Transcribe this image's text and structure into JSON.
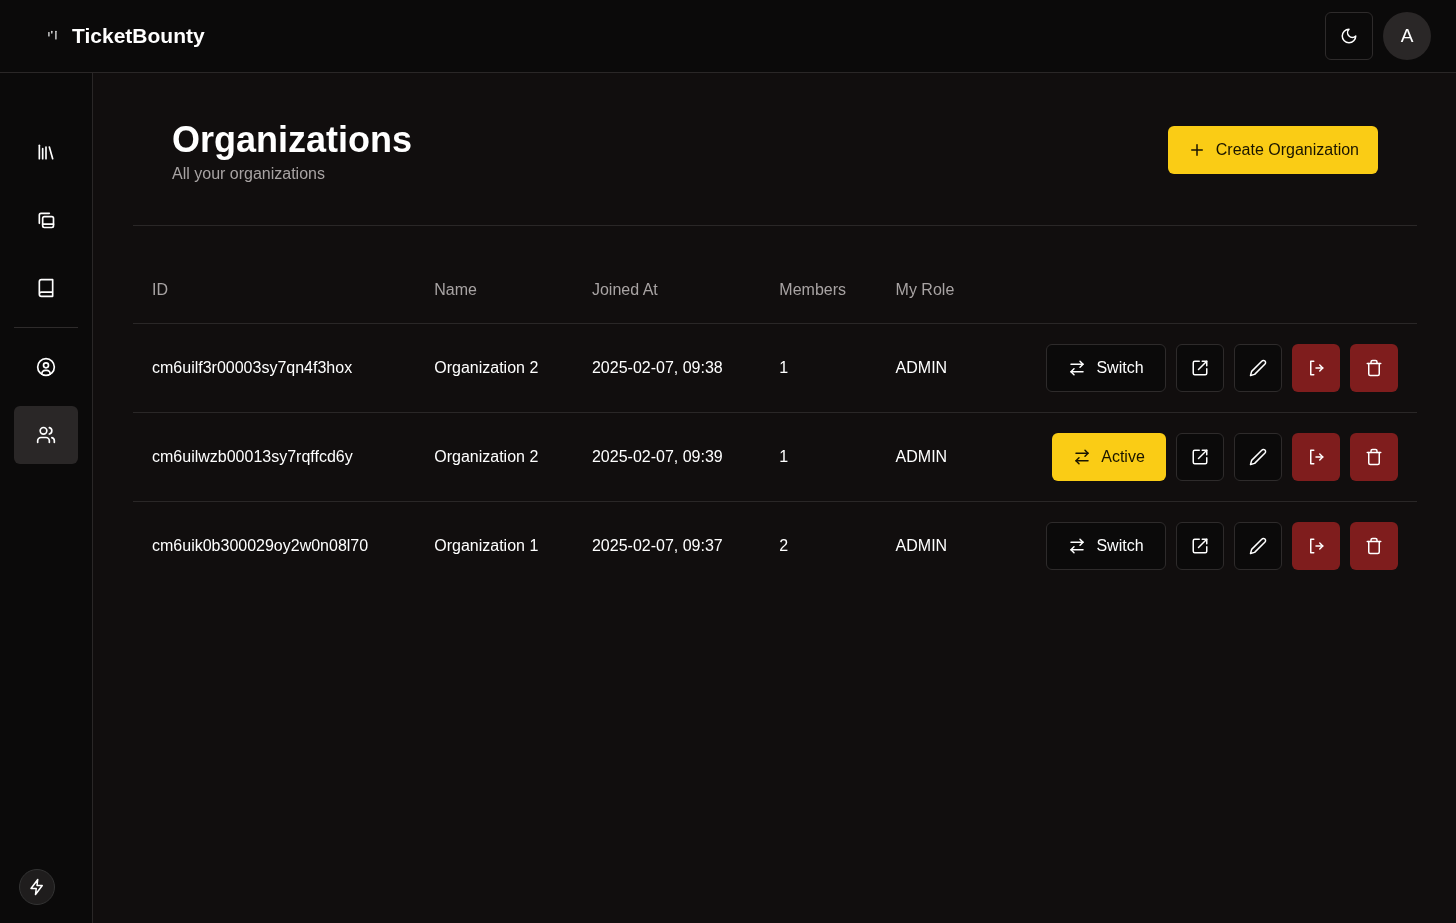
{
  "app": {
    "name": "TicketBounty"
  },
  "header": {
    "avatar": "A"
  },
  "sidebar": {
    "items": [
      {
        "kind": "library",
        "selected": false
      },
      {
        "kind": "copies",
        "selected": false
      },
      {
        "kind": "book",
        "selected": false
      },
      {
        "kind": "account",
        "selected": false
      },
      {
        "kind": "users",
        "selected": true
      }
    ]
  },
  "page": {
    "title": "Organizations",
    "subtitle": "All your organizations",
    "create_button": "Create Organization"
  },
  "table": {
    "columns": [
      "ID",
      "Name",
      "Joined At",
      "Members",
      "My Role"
    ],
    "rows": [
      {
        "id": "cm6uilf3r00003sy7qn4f3hox",
        "name": "Organization 2",
        "joined_at": "2025-02-07, 09:38",
        "members": "1",
        "role": "ADMIN",
        "selected": false,
        "switch_label": "Switch"
      },
      {
        "id": "cm6uilwzb00013sy7rqffcd6y",
        "name": "Organization 2",
        "joined_at": "2025-02-07, 09:39",
        "members": "1",
        "role": "ADMIN",
        "selected": true,
        "switch_label": "Active"
      },
      {
        "id": "cm6uik0b300029oy2w0n08l70",
        "name": "Organization 1",
        "joined_at": "2025-02-07, 09:37",
        "members": "2",
        "role": "ADMIN",
        "selected": false,
        "switch_label": "Switch"
      }
    ]
  }
}
